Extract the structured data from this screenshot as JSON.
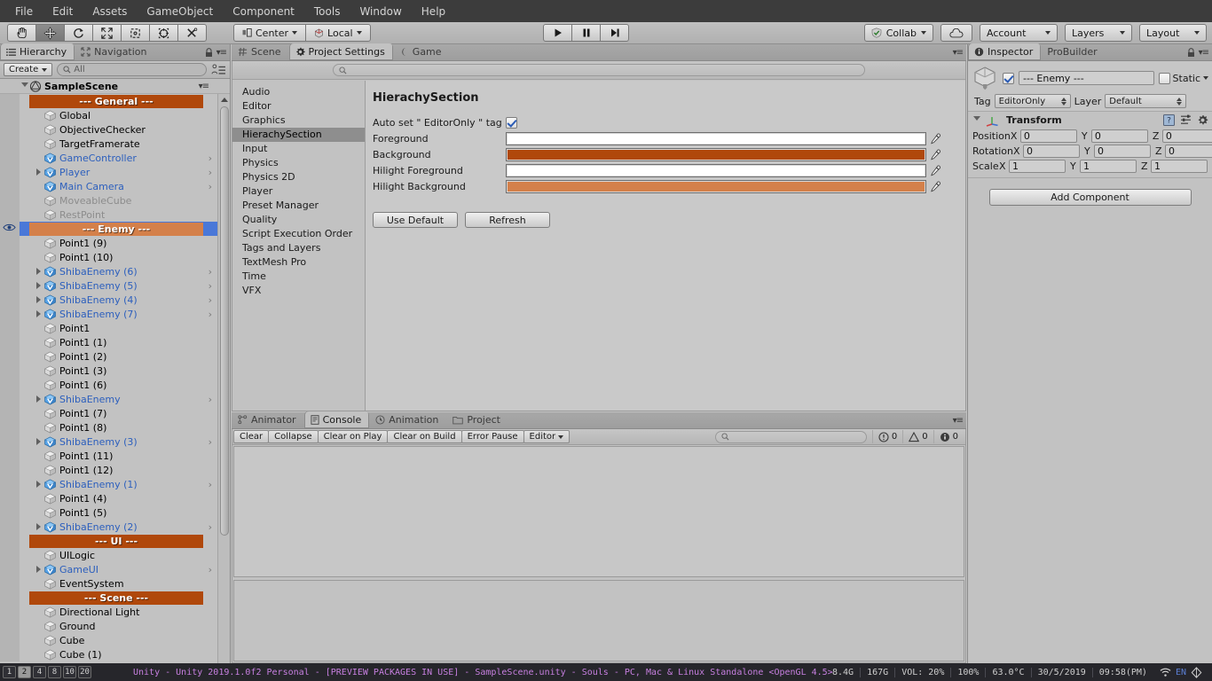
{
  "menu": {
    "items": [
      "File",
      "Edit",
      "Assets",
      "GameObject",
      "Component",
      "Tools",
      "Window",
      "Help"
    ]
  },
  "toolbar": {
    "tools": [
      {
        "name": "hand-tool",
        "icon": "hand-icon",
        "active": false
      },
      {
        "name": "move-tool",
        "icon": "move-icon",
        "active": true
      },
      {
        "name": "rotate-tool",
        "icon": "rotate-icon",
        "active": false
      },
      {
        "name": "scale-tool",
        "icon": "scale-icon",
        "active": false
      },
      {
        "name": "rect-tool",
        "icon": "rect-icon",
        "active": false
      },
      {
        "name": "transform-tool",
        "icon": "transform-icon",
        "active": false
      },
      {
        "name": "custom-tool",
        "icon": "wrench-icon",
        "active": false
      }
    ],
    "pivot_label": "Center",
    "space_label": "Local",
    "play_label": "play-icon",
    "pause_label": "pause-icon",
    "step_label": "step-icon",
    "collab_label": "Collab",
    "cloud_label": "cloud-icon",
    "account_label": "Account",
    "layers_label": "Layers",
    "layout_label": "Layout"
  },
  "hierarchy": {
    "tabs": [
      {
        "label": "Hierarchy",
        "active": true,
        "icon": "hierarchy-icon"
      },
      {
        "label": "Navigation",
        "active": false,
        "icon": "navigation-icon"
      }
    ],
    "create_label": "Create",
    "search_placeholder": "All",
    "scene_name": "SampleScene",
    "rows": [
      {
        "label": "--- General ---",
        "type": "section",
        "indent": 0
      },
      {
        "label": "Global",
        "type": "object",
        "indent": 1
      },
      {
        "label": "ObjectiveChecker",
        "type": "object",
        "indent": 1
      },
      {
        "label": "TargetFramerate",
        "type": "object",
        "indent": 1
      },
      {
        "label": "GameController",
        "type": "prefab",
        "indent": 1,
        "chevron": true
      },
      {
        "label": "Player",
        "type": "prefab",
        "indent": 1,
        "expand": true,
        "chevron": true
      },
      {
        "label": "Main Camera",
        "type": "prefab",
        "indent": 1,
        "chevron": true
      },
      {
        "label": "MoveableCube",
        "type": "dim",
        "indent": 1
      },
      {
        "label": "RestPoint",
        "type": "dim",
        "indent": 1
      },
      {
        "label": "--- Enemy ---",
        "type": "section",
        "indent": 0,
        "selected": true
      },
      {
        "label": "Point1 (9)",
        "type": "object",
        "indent": 1
      },
      {
        "label": "Point1 (10)",
        "type": "object",
        "indent": 1
      },
      {
        "label": "ShibaEnemy (6)",
        "type": "prefab",
        "indent": 1,
        "expand": true,
        "chevron": true
      },
      {
        "label": "ShibaEnemy (5)",
        "type": "prefab",
        "indent": 1,
        "expand": true,
        "chevron": true
      },
      {
        "label": "ShibaEnemy (4)",
        "type": "prefab",
        "indent": 1,
        "expand": true,
        "chevron": true
      },
      {
        "label": "ShibaEnemy (7)",
        "type": "prefab",
        "indent": 1,
        "expand": true,
        "chevron": true
      },
      {
        "label": "Point1",
        "type": "object",
        "indent": 1
      },
      {
        "label": "Point1 (1)",
        "type": "object",
        "indent": 1
      },
      {
        "label": "Point1 (2)",
        "type": "object",
        "indent": 1
      },
      {
        "label": "Point1 (3)",
        "type": "object",
        "indent": 1
      },
      {
        "label": "Point1 (6)",
        "type": "object",
        "indent": 1
      },
      {
        "label": "ShibaEnemy",
        "type": "prefab",
        "indent": 1,
        "expand": true,
        "chevron": true
      },
      {
        "label": "Point1 (7)",
        "type": "object",
        "indent": 1
      },
      {
        "label": "Point1 (8)",
        "type": "object",
        "indent": 1
      },
      {
        "label": "ShibaEnemy (3)",
        "type": "prefab",
        "indent": 1,
        "expand": true,
        "chevron": true
      },
      {
        "label": "Point1 (11)",
        "type": "object",
        "indent": 1
      },
      {
        "label": "Point1 (12)",
        "type": "object",
        "indent": 1
      },
      {
        "label": "ShibaEnemy (1)",
        "type": "prefab",
        "indent": 1,
        "expand": true,
        "chevron": true
      },
      {
        "label": "Point1 (4)",
        "type": "object",
        "indent": 1
      },
      {
        "label": "Point1 (5)",
        "type": "object",
        "indent": 1
      },
      {
        "label": "ShibaEnemy (2)",
        "type": "prefab",
        "indent": 1,
        "expand": true,
        "chevron": true
      },
      {
        "label": "--- UI ---",
        "type": "section",
        "indent": 0
      },
      {
        "label": "UILogic",
        "type": "object",
        "indent": 1
      },
      {
        "label": "GameUI",
        "type": "prefab",
        "indent": 1,
        "expand": true,
        "chevron": true
      },
      {
        "label": "EventSystem",
        "type": "object",
        "indent": 1
      },
      {
        "label": "--- Scene ---",
        "type": "section",
        "indent": 0
      },
      {
        "label": "Directional Light",
        "type": "object",
        "indent": 1
      },
      {
        "label": "Ground",
        "type": "object",
        "indent": 1
      },
      {
        "label": "Cube",
        "type": "object",
        "indent": 1
      },
      {
        "label": "Cube (1)",
        "type": "object",
        "indent": 1
      }
    ]
  },
  "center": {
    "tabs": [
      {
        "label": "Scene",
        "active": false,
        "icon": "scene-icon"
      },
      {
        "label": "Project Settings",
        "active": true,
        "icon": "gear-icon"
      },
      {
        "label": "Game",
        "active": false,
        "icon": "game-icon"
      }
    ],
    "search_placeholder": "",
    "settings_list": [
      "Audio",
      "Editor",
      "Graphics",
      "HierachySection",
      "Input",
      "Physics",
      "Physics 2D",
      "Player",
      "Preset Manager",
      "Quality",
      "Script Execution Order",
      "Tags and Layers",
      "TextMesh Pro",
      "Time",
      "VFX"
    ],
    "selected_setting": "HierachySection",
    "page_title": "HierachySection",
    "auto_set_label": "Auto set \" EditorOnly \" tag",
    "auto_set_checked": true,
    "color_fields": [
      {
        "label": "Foreground",
        "color": "#ffffff"
      },
      {
        "label": "Background",
        "color": "#b0480b"
      },
      {
        "label": "Hilight Foreground",
        "color": "#ffffff"
      },
      {
        "label": "Hilight Background",
        "color": "#d4804a"
      }
    ],
    "use_default_label": "Use Default",
    "refresh_label": "Refresh"
  },
  "console": {
    "tabs": [
      {
        "label": "Animator",
        "active": false,
        "icon": "animator-icon"
      },
      {
        "label": "Console",
        "active": true,
        "icon": "console-icon"
      },
      {
        "label": "Animation",
        "active": false,
        "icon": "animation-icon"
      },
      {
        "label": "Project",
        "active": false,
        "icon": "project-icon"
      }
    ],
    "buttons": [
      "Clear",
      "Collapse",
      "Clear on Play",
      "Clear on Build",
      "Error Pause"
    ],
    "editor_label": "Editor",
    "search_placeholder": "",
    "error_count": "0",
    "warning_count": "0",
    "info_count": "0"
  },
  "inspector": {
    "tabs": [
      {
        "label": "Inspector",
        "active": true,
        "icon": "info-icon"
      },
      {
        "label": "ProBuilder",
        "active": false,
        "icon": "probuilder-icon"
      }
    ],
    "enabled": true,
    "object_name": "--- Enemy ---",
    "static_label": "Static",
    "static_checked": false,
    "tag_label": "Tag",
    "tag_value": "EditorOnly",
    "layer_label": "Layer",
    "layer_value": "Default",
    "transform": {
      "title": "Transform",
      "rows": [
        {
          "label": "Position",
          "x": "0",
          "y": "0",
          "z": "0"
        },
        {
          "label": "Rotation",
          "x": "0",
          "y": "0",
          "z": "0"
        },
        {
          "label": "Scale",
          "x": "1",
          "y": "1",
          "z": "1"
        }
      ]
    },
    "add_component_label": "Add Component"
  },
  "statusbar": {
    "workspaces": [
      {
        "label": "1",
        "active": false
      },
      {
        "label": "2",
        "active": true
      },
      {
        "label": "4",
        "active": false
      },
      {
        "label": "8",
        "active": false
      },
      {
        "label": "10",
        "active": false
      },
      {
        "label": "20",
        "active": false
      }
    ],
    "title": "Unity - Unity 2019.1.0f2 Personal - [PREVIEW PACKAGES IN USE] - SampleScene.unity - Souls - PC, Mac & Linux Standalone <OpenGL 4.5>",
    "cells": [
      "8.4G",
      "167G",
      "VOL: 20%",
      "100%",
      "63.0°C",
      "30/5/2019",
      "09:58(PM)"
    ],
    "wifi_icon": "wifi-icon",
    "lang": "EN",
    "unity_icon": "unity-icon"
  }
}
